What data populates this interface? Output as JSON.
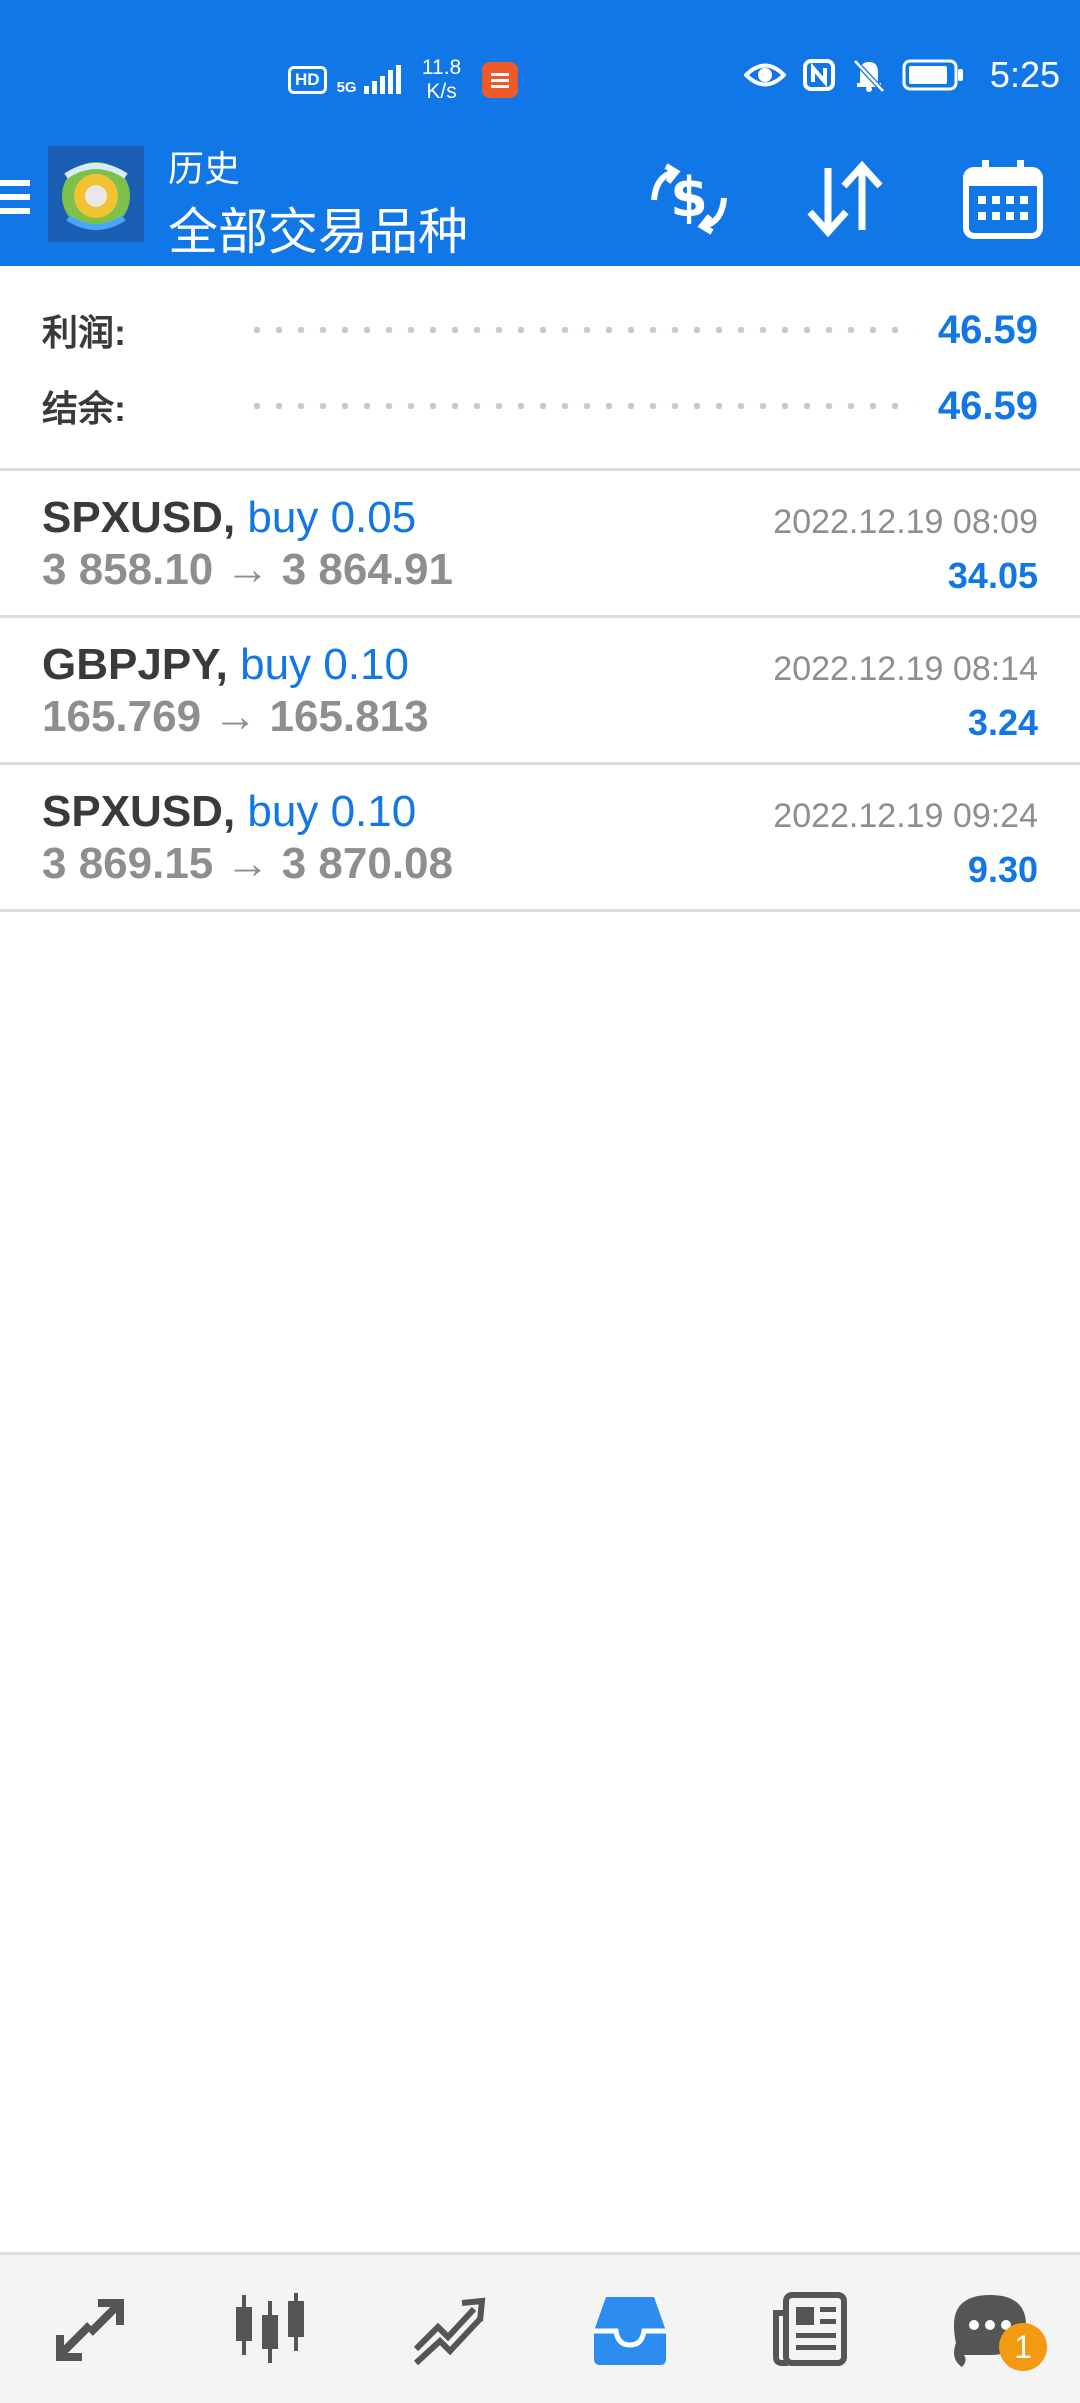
{
  "status_bar": {
    "hd": "HD",
    "network": "5G",
    "speed_value": "11.8",
    "speed_unit": "K/s",
    "time": "5:25"
  },
  "toolbar": {
    "title_small": "历史",
    "title_big": "全部交易品种"
  },
  "summary": {
    "profit_label": "利润:",
    "profit_value": "46.59",
    "balance_label": "结余:",
    "balance_value": "46.59"
  },
  "trades": [
    {
      "symbol": "SPXUSD,",
      "direction": "buy 0.05",
      "prices": "3 858.10 → 3 864.91",
      "time": "2022.12.19 08:09",
      "profit": "34.05"
    },
    {
      "symbol": "GBPJPY,",
      "direction": "buy 0.10",
      "prices": "165.769 → 165.813",
      "time": "2022.12.19 08:14",
      "profit": "3.24"
    },
    {
      "symbol": "SPXUSD,",
      "direction": "buy 0.10",
      "prices": "3 869.15 → 3 870.08",
      "time": "2022.12.19 09:24",
      "profit": "9.30"
    }
  ],
  "bottom_nav": {
    "items": [
      "quotes-icon",
      "chart-icon",
      "trade-icon",
      "history-icon",
      "news-icon",
      "chat-icon"
    ],
    "active": "history-icon",
    "chat_badge": "1"
  },
  "colors": {
    "accent": "#1177e6",
    "header_bg": "#1177e6",
    "muted_text": "#8e8e8e",
    "badge": "#f39a13"
  }
}
